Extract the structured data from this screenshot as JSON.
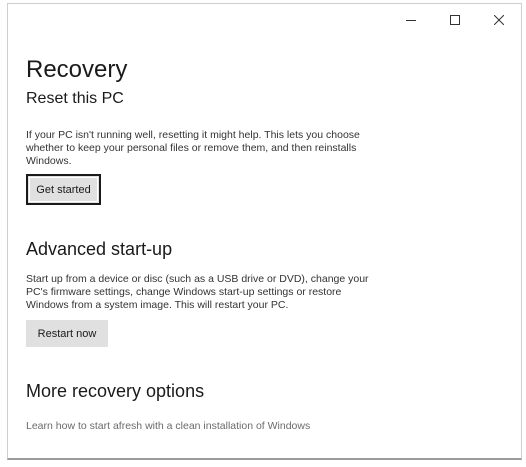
{
  "window": {
    "app_name": "",
    "caption_icons": {
      "minimize": "minimize-icon",
      "maximize": "maximize-icon",
      "close": "close-icon"
    }
  },
  "page": {
    "title": "Recovery"
  },
  "reset": {
    "title": "Reset this PC",
    "description": "If your PC isn't running well, resetting it might help. This lets you choose whether to keep your personal files or remove them, and then reinstalls Windows.",
    "button_label": "Get started"
  },
  "advanced": {
    "title": "Advanced start-up",
    "description": "Start up from a device or disc (such as a USB drive or DVD), change your PC's firmware settings, change Windows start-up settings or restore Windows from a system image. This will restart your PC.",
    "button_label": "Restart now"
  },
  "more": {
    "title": "More recovery options",
    "link_text": "Learn how to start afresh with a clean installation of Windows"
  },
  "colors": {
    "button_bg": "#e0e0e0",
    "focus_border": "#1a1a1a",
    "link_text": "#6b6b6b"
  }
}
